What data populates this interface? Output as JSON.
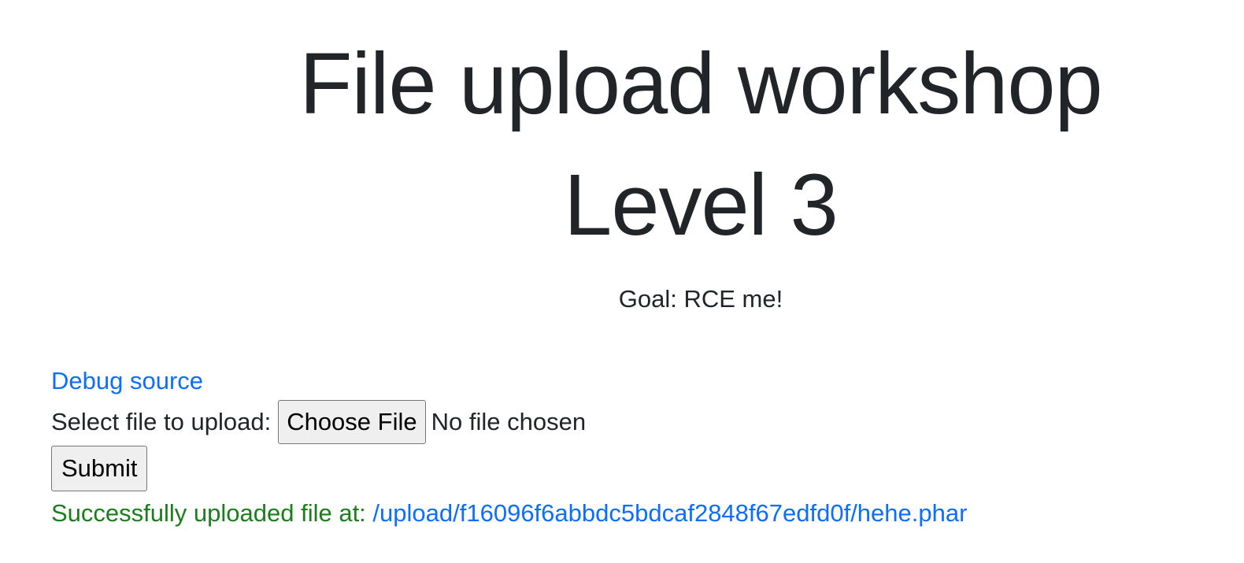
{
  "header": {
    "title_line1": "File upload workshop",
    "title_line2": "Level 3",
    "goal": "Goal: RCE me!"
  },
  "debug": {
    "link_label": "Debug source"
  },
  "upload": {
    "label": "Select file to upload:",
    "choose_button": "Choose File",
    "file_status": "No file chosen",
    "submit_button": "Submit"
  },
  "result": {
    "message": "Successfully uploaded file at:",
    "path": "/upload/f16096f6abbdc5bdcaf2848f67edfd0f/hehe.phar"
  },
  "colors": {
    "text": "#212529",
    "link": "#0d6efd",
    "success": "#1a7f1a",
    "button_bg": "#efefef"
  }
}
